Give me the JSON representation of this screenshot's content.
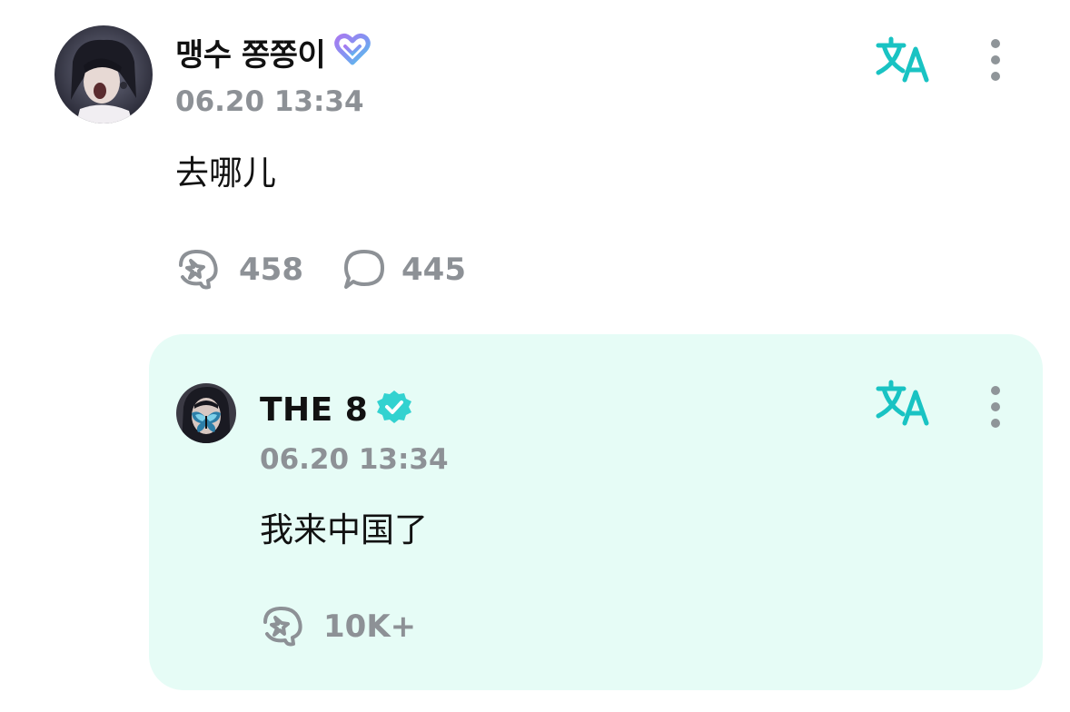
{
  "post": {
    "author": "맹수 쫑쫑이",
    "author_badge_icon": "heart-badge-icon",
    "timestamp": "06.20 13:34",
    "text": "去哪儿",
    "likes": "458",
    "comments": "445",
    "translate_icon": "translate-icon",
    "more_icon": "more-vertical-icon"
  },
  "reply": {
    "author": "THE 8",
    "author_badge_icon": "verified-badge-icon",
    "timestamp": "06.20 13:34",
    "text": "我来中国了",
    "likes": "10K+",
    "translate_icon": "translate-icon",
    "more_icon": "more-vertical-icon"
  },
  "colors": {
    "accent_teal": "#19c3c3",
    "verified": "#33d2d0",
    "reply_background": "#e6fcf6",
    "meta_text": "#8d9196",
    "primary_text": "#111111"
  }
}
